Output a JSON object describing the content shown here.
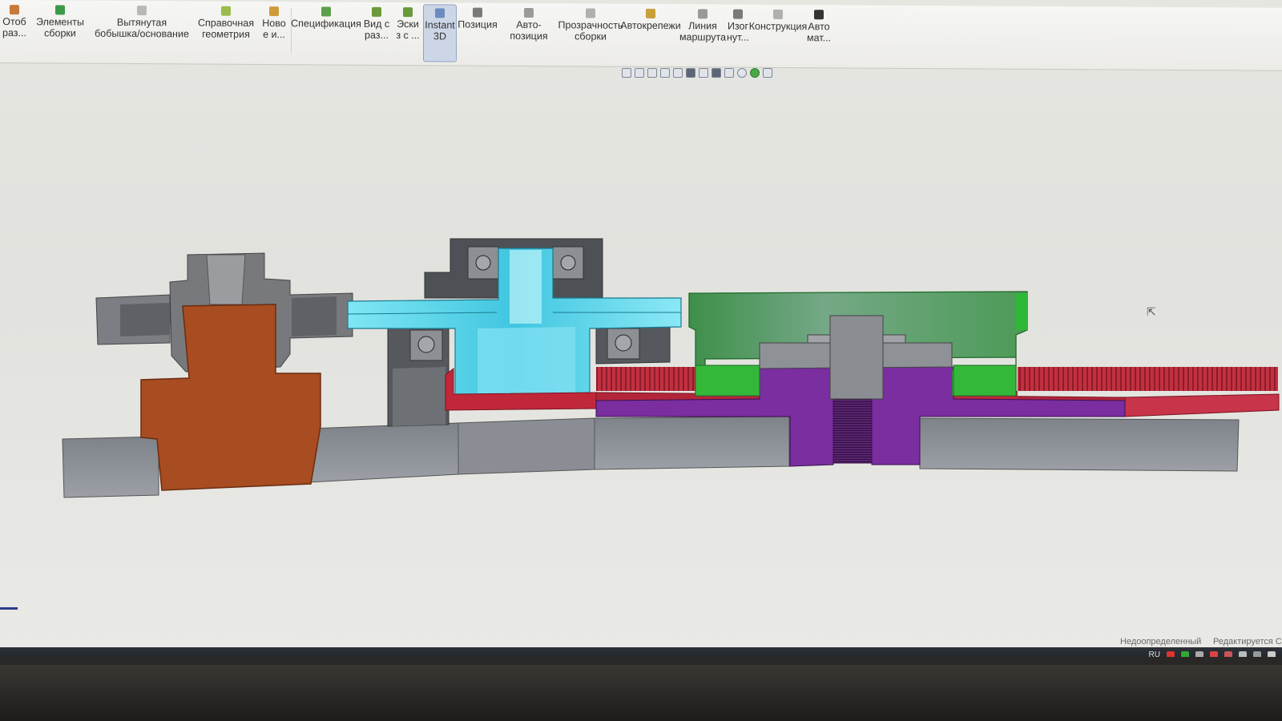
{
  "ribbon": {
    "buttons": [
      {
        "id": "explode",
        "label": "Отоб\nраз...",
        "icon": "explode-icon",
        "color": "#c77a3a"
      },
      {
        "id": "assembly-features",
        "label": "Элементы\nсборки",
        "icon": "assembly-features-icon",
        "color": "#3a9a4a"
      },
      {
        "id": "extruded-boss",
        "label": "Вытянутая\nбобышка/основание",
        "icon": "extrude-icon",
        "color": "#b8b8b8"
      },
      {
        "id": "reference-geometry",
        "label": "Справочная\nгеометрия",
        "icon": "reference-geometry-icon",
        "color": "#9bbc4a"
      },
      {
        "id": "new-part",
        "label": "Ново\nе и...",
        "icon": "new-part-icon",
        "color": "#d09a3a"
      },
      {
        "id": "bom",
        "label": "Спецификация",
        "icon": "bom-icon",
        "color": "#5aa04a"
      },
      {
        "id": "exploded-view",
        "label": "Вид с\nраз...",
        "icon": "exploded-view-icon",
        "color": "#6a9a3a"
      },
      {
        "id": "sketch",
        "label": "Эски\nз с ...",
        "icon": "sketch-icon",
        "color": "#6a9a3a"
      },
      {
        "id": "instant3d",
        "label": "Instant\n3D",
        "icon": "instant3d-icon",
        "color": "#6a8cc0",
        "active": true
      },
      {
        "id": "position",
        "label": "Позиция",
        "icon": "position-icon",
        "color": "#7a7a7a"
      },
      {
        "id": "auto-position",
        "label": "Авто-позиция",
        "icon": "auto-position-icon",
        "color": "#9a9a9a"
      },
      {
        "id": "assembly-transparency",
        "label": "Прозрачность\nсборки",
        "icon": "transparency-icon",
        "color": "#b0b0b0"
      },
      {
        "id": "smart-fasteners",
        "label": "Автокрепежи",
        "icon": "fastener-icon",
        "color": "#c8a03a"
      },
      {
        "id": "route-line",
        "label": "Линия\nмаршрута",
        "icon": "route-icon",
        "color": "#9a9a9a"
      },
      {
        "id": "cosmetic-thread",
        "label": "Изог\nнут...",
        "icon": "cosmetic-thread-icon",
        "color": "#7a7a7a"
      },
      {
        "id": "construction",
        "label": "Конструкция",
        "icon": "construction-icon",
        "color": "#b0b0b0"
      },
      {
        "id": "auto-mate",
        "label": "Авто\nмат...",
        "icon": "auto-mate-icon",
        "color": "#333333"
      }
    ]
  },
  "status": {
    "definition": "Недоопределенный",
    "editing": "Редактируется С"
  },
  "taskbar": {
    "language": "RU"
  },
  "colors": {
    "orange_part": "#a84c22",
    "cyan_part": "#5ed8ec",
    "green_part": "#3fa03f",
    "red_gear": "#c0283a",
    "purple_part": "#7a2ea0",
    "gray_base": "#8f9399"
  }
}
